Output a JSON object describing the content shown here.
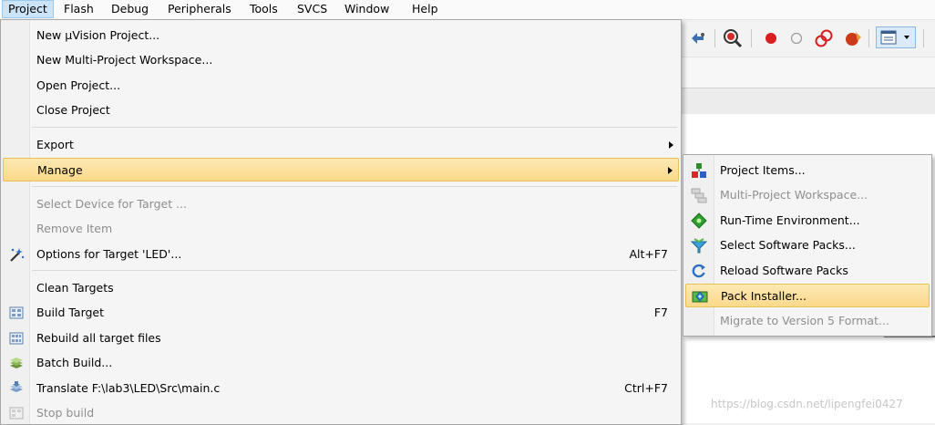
{
  "menubar": {
    "items": [
      "Project",
      "Flash",
      "Debug",
      "Peripherals",
      "Tools",
      "SVCS",
      "Window",
      "Help"
    ]
  },
  "project_menu": {
    "items": [
      {
        "label": "New µVision Project...",
        "shortcut": "",
        "disabled": false
      },
      {
        "label": "New Multi-Project Workspace...",
        "shortcut": "",
        "disabled": false
      },
      {
        "label": "Open Project...",
        "shortcut": "",
        "disabled": false
      },
      {
        "label": "Close Project",
        "shortcut": "",
        "disabled": false
      },
      {
        "label": "Export",
        "shortcut": "",
        "disabled": false,
        "submenu": true
      },
      {
        "label": "Manage",
        "shortcut": "",
        "disabled": false,
        "submenu": true,
        "highlighted": true
      },
      {
        "label": "Select Device for Target ...",
        "shortcut": "",
        "disabled": true
      },
      {
        "label": "Remove Item",
        "shortcut": "",
        "disabled": true
      },
      {
        "label": "Options for Target 'LED'...",
        "shortcut": "Alt+F7",
        "disabled": false,
        "icon": "magic-wand-icon"
      },
      {
        "label": "Clean Targets",
        "shortcut": "",
        "disabled": false
      },
      {
        "label": "Build Target",
        "shortcut": "F7",
        "disabled": false,
        "icon": "build-icon"
      },
      {
        "label": "Rebuild all target files",
        "shortcut": "",
        "disabled": false,
        "icon": "rebuild-icon"
      },
      {
        "label": "Batch Build...",
        "shortcut": "",
        "disabled": false,
        "icon": "batch-build-icon"
      },
      {
        "label": "Translate F:\\lab3\\LED\\Src\\main.c",
        "shortcut": "Ctrl+F7",
        "disabled": false,
        "icon": "translate-icon"
      },
      {
        "label": "Stop build",
        "shortcut": "",
        "disabled": true,
        "icon": "stop-build-icon"
      }
    ]
  },
  "manage_submenu": {
    "items": [
      {
        "label": "Project Items...",
        "disabled": false,
        "icon": "project-items-icon"
      },
      {
        "label": "Multi-Project Workspace...",
        "disabled": true,
        "icon": "multi-project-icon"
      },
      {
        "label": "Run-Time Environment...",
        "disabled": false,
        "icon": "runtime-env-icon"
      },
      {
        "label": "Select Software Packs...",
        "disabled": false,
        "icon": "select-packs-icon"
      },
      {
        "label": "Reload Software Packs",
        "disabled": false,
        "icon": "reload-icon"
      },
      {
        "label": "Pack Installer...",
        "disabled": false,
        "icon": "pack-installer-icon",
        "highlighted": true
      },
      {
        "label": "Migrate to Version 5 Format...",
        "disabled": true
      }
    ]
  },
  "watermark": "https://blog.csdn.net/lipengfei0427",
  "colors": {
    "highlight_fill": "#fbd98a",
    "highlight_border": "#e7bf52",
    "menubar_active": "#cce4f7",
    "disabled_text": "#8e8e8e"
  }
}
